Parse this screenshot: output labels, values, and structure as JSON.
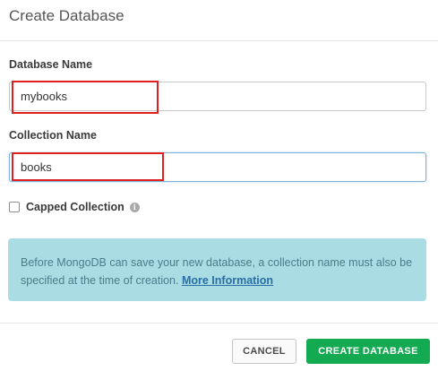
{
  "dialog": {
    "title": "Create Database"
  },
  "form": {
    "database_label": "Database Name",
    "database_value": "mybooks",
    "collection_label": "Collection Name",
    "collection_value": "books",
    "capped_label": "Capped Collection",
    "capped_checked": false,
    "info_icon_glyph": "i"
  },
  "info": {
    "text": "Before MongoDB can save your new database, a collection name must also be specified at the time of creation. ",
    "link_label": "More Information"
  },
  "buttons": {
    "cancel_label": "CANCEL",
    "create_label": "CREATE DATABASE"
  },
  "colors": {
    "highlight": "#e02020",
    "info_bg": "#a9dde3",
    "primary": "#13aa52"
  }
}
